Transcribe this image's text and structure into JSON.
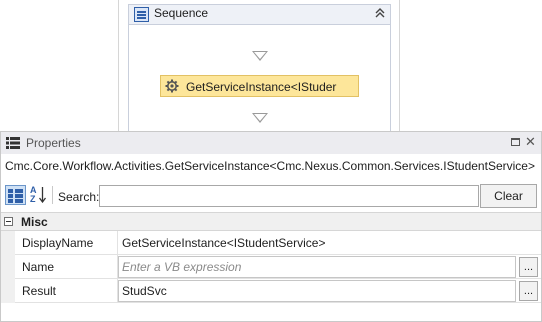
{
  "designer": {
    "sequence": {
      "title": "Sequence",
      "icon": "sequence-icon",
      "collapse_icon": "double-chevron-up-icon"
    },
    "activity": {
      "label": "GetServiceInstance<IStuder",
      "icon": "gear-icon",
      "color": "#fde69a"
    }
  },
  "properties": {
    "title": "Properties",
    "type_name": "Cmc.Core.Workflow.Activities.GetServiceInstance<Cmc.Nexus.Common.Services.IStudentService>",
    "toolbar": {
      "categorized_icon": "categorized-icon",
      "alphabetical_icon": "sort-alphabetical-icon",
      "alpha_a": "A",
      "alpha_z": "Z",
      "search_label": "Search:",
      "search_value": "",
      "clear_label": "Clear"
    },
    "category": {
      "label": "Misc",
      "expanded": true
    },
    "rows": [
      {
        "name": "DisplayName",
        "value": "GetServiceInstance<IStudentService>"
      },
      {
        "name": "Name",
        "value": "",
        "placeholder": "Enter a VB expression",
        "button_label": "..."
      },
      {
        "name": "Result",
        "value": "StudSvc",
        "button_label": "..."
      }
    ]
  }
}
